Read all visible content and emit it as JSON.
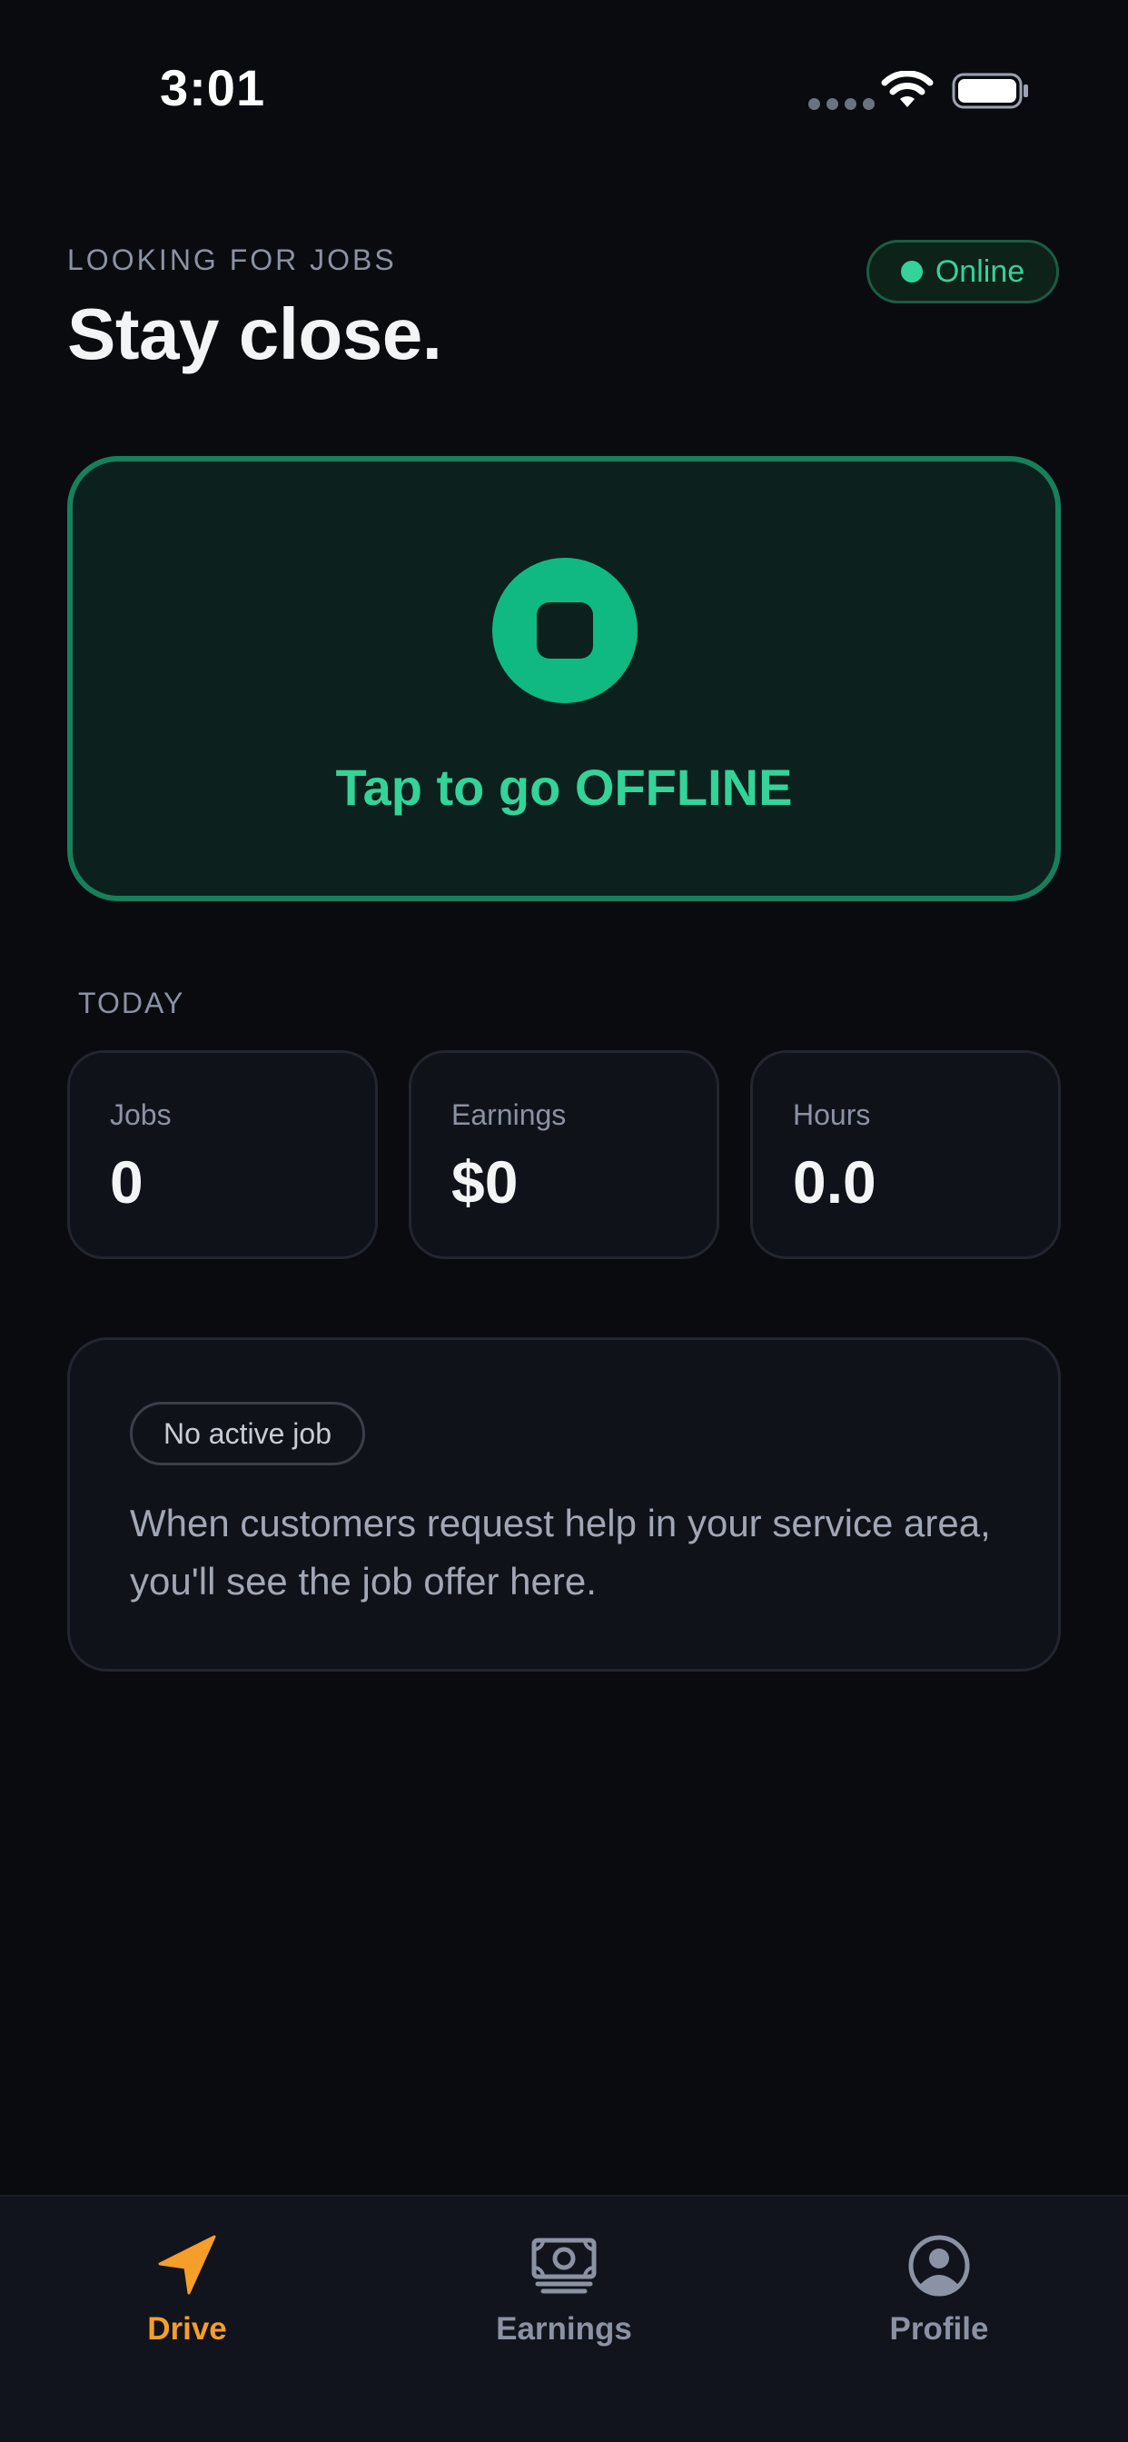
{
  "status_bar": {
    "time": "3:01"
  },
  "header": {
    "eyebrow": "LOOKING FOR JOBS",
    "title": "Stay close.",
    "status_pill": "Online"
  },
  "toggle": {
    "label": "Tap to go OFFLINE"
  },
  "today": {
    "section_label": "TODAY",
    "stats": [
      {
        "label": "Jobs",
        "value": "0"
      },
      {
        "label": "Earnings",
        "value": "$0"
      },
      {
        "label": "Hours",
        "value": "0.0"
      }
    ]
  },
  "active_job": {
    "badge": "No active job",
    "message": "When customers request help in your service area, you'll see the job offer here."
  },
  "tabs": [
    {
      "label": "Drive",
      "icon": "navigation-arrow-icon",
      "active": true
    },
    {
      "label": "Earnings",
      "icon": "cash-icon",
      "active": false
    },
    {
      "label": "Profile",
      "icon": "user-circle-icon",
      "active": false
    }
  ],
  "colors": {
    "background": "#0a0b0f",
    "accent_green": "#34d399",
    "button_green": "#10b981",
    "active_tab": "#f59e2a",
    "inactive_tab": "#8b92a3"
  }
}
